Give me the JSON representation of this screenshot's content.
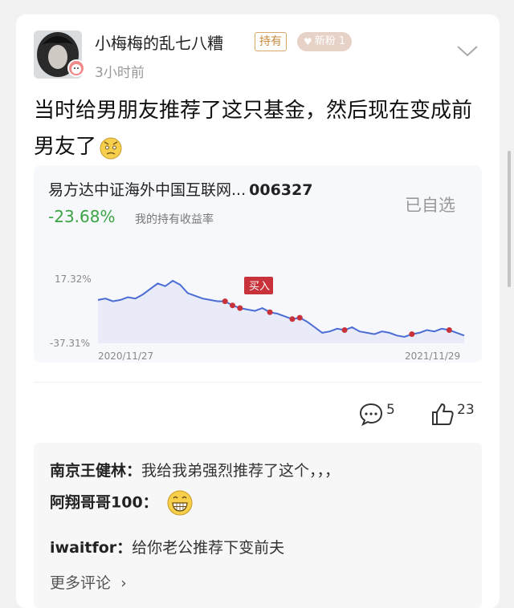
{
  "post": {
    "username": "小梅梅的乱七八糟",
    "tag_hold": "持有",
    "tag_fan": "新粉 1",
    "time": "3小时前",
    "text": "当时给男朋友推荐了这只基金，然后现在变成前男友了"
  },
  "fund": {
    "name": "易方达中证海外中国互联网...",
    "code": "006327",
    "return_value": "-23.68%",
    "return_label": "我的持有收益率",
    "selected_label": "已自选",
    "buy_label": "买入",
    "y_high": "17.32%",
    "y_low": "-37.31%",
    "x_start": "2020/11/27",
    "x_end": "2021/11/29"
  },
  "chart_data": {
    "type": "line",
    "title": "",
    "xlabel": "",
    "ylabel": "",
    "ylim": [
      -37.31,
      17.32
    ],
    "x_range": [
      "2020/11/27",
      "2021/11/29"
    ],
    "series": [
      {
        "values": [
          0,
          1,
          -1,
          0,
          2,
          1,
          4,
          8,
          12,
          10,
          14,
          11,
          5,
          3,
          1,
          0,
          -1,
          -1,
          -4,
          -6,
          -7,
          -8,
          -6,
          -9,
          -10,
          -12,
          -14,
          -13,
          -16,
          -20,
          -24,
          -23,
          -21,
          -22,
          -20,
          -23,
          -24,
          -25,
          -23,
          -24,
          -26,
          -27,
          -25,
          -24,
          -22,
          -23,
          -21,
          -22,
          -24,
          -26
        ]
      }
    ],
    "markers_index": [
      17,
      18,
      19,
      23,
      26,
      27,
      33,
      42,
      47
    ]
  },
  "actions": {
    "comment_count": "5",
    "like_count": "23"
  },
  "comments": {
    "c1_author": "南京王健林：",
    "c1_text": "我给我弟强烈推荐了这个，，，",
    "c2_author": "阿翔哥哥100：",
    "c3_author": "iwaitfor：",
    "c3_text": "给你老公推荐下变前夫",
    "more": "更多评论"
  },
  "colors": {
    "line": "#4a6cd4",
    "marker": "#c8323a",
    "return_green": "#3aa344",
    "buy_tag": "#c8323a"
  }
}
